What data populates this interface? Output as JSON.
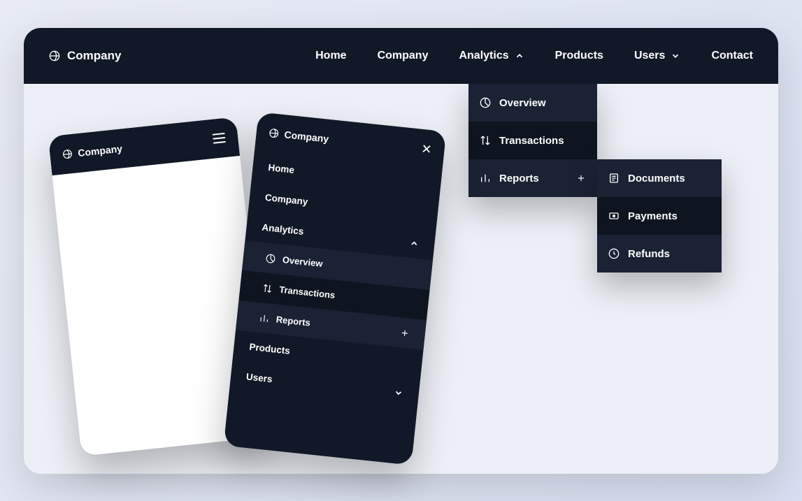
{
  "brand": "Company",
  "nav": {
    "home": "Home",
    "company": "Company",
    "analytics": "Analytics",
    "products": "Products",
    "users": "Users",
    "contact": "Contact"
  },
  "analytics_dropdown": {
    "overview": "Overview",
    "transactions": "Transactions",
    "reports": "Reports"
  },
  "reports_submenu": {
    "documents": "Documents",
    "payments": "Payments",
    "refunds": "Refunds"
  },
  "mobile_a": {
    "brand": "Company"
  },
  "mobile_b": {
    "brand": "Company",
    "home": "Home",
    "company": "Company",
    "analytics": "Analytics",
    "overview": "Overview",
    "transactions": "Transactions",
    "reports": "Reports",
    "products": "Products",
    "users": "Users"
  }
}
